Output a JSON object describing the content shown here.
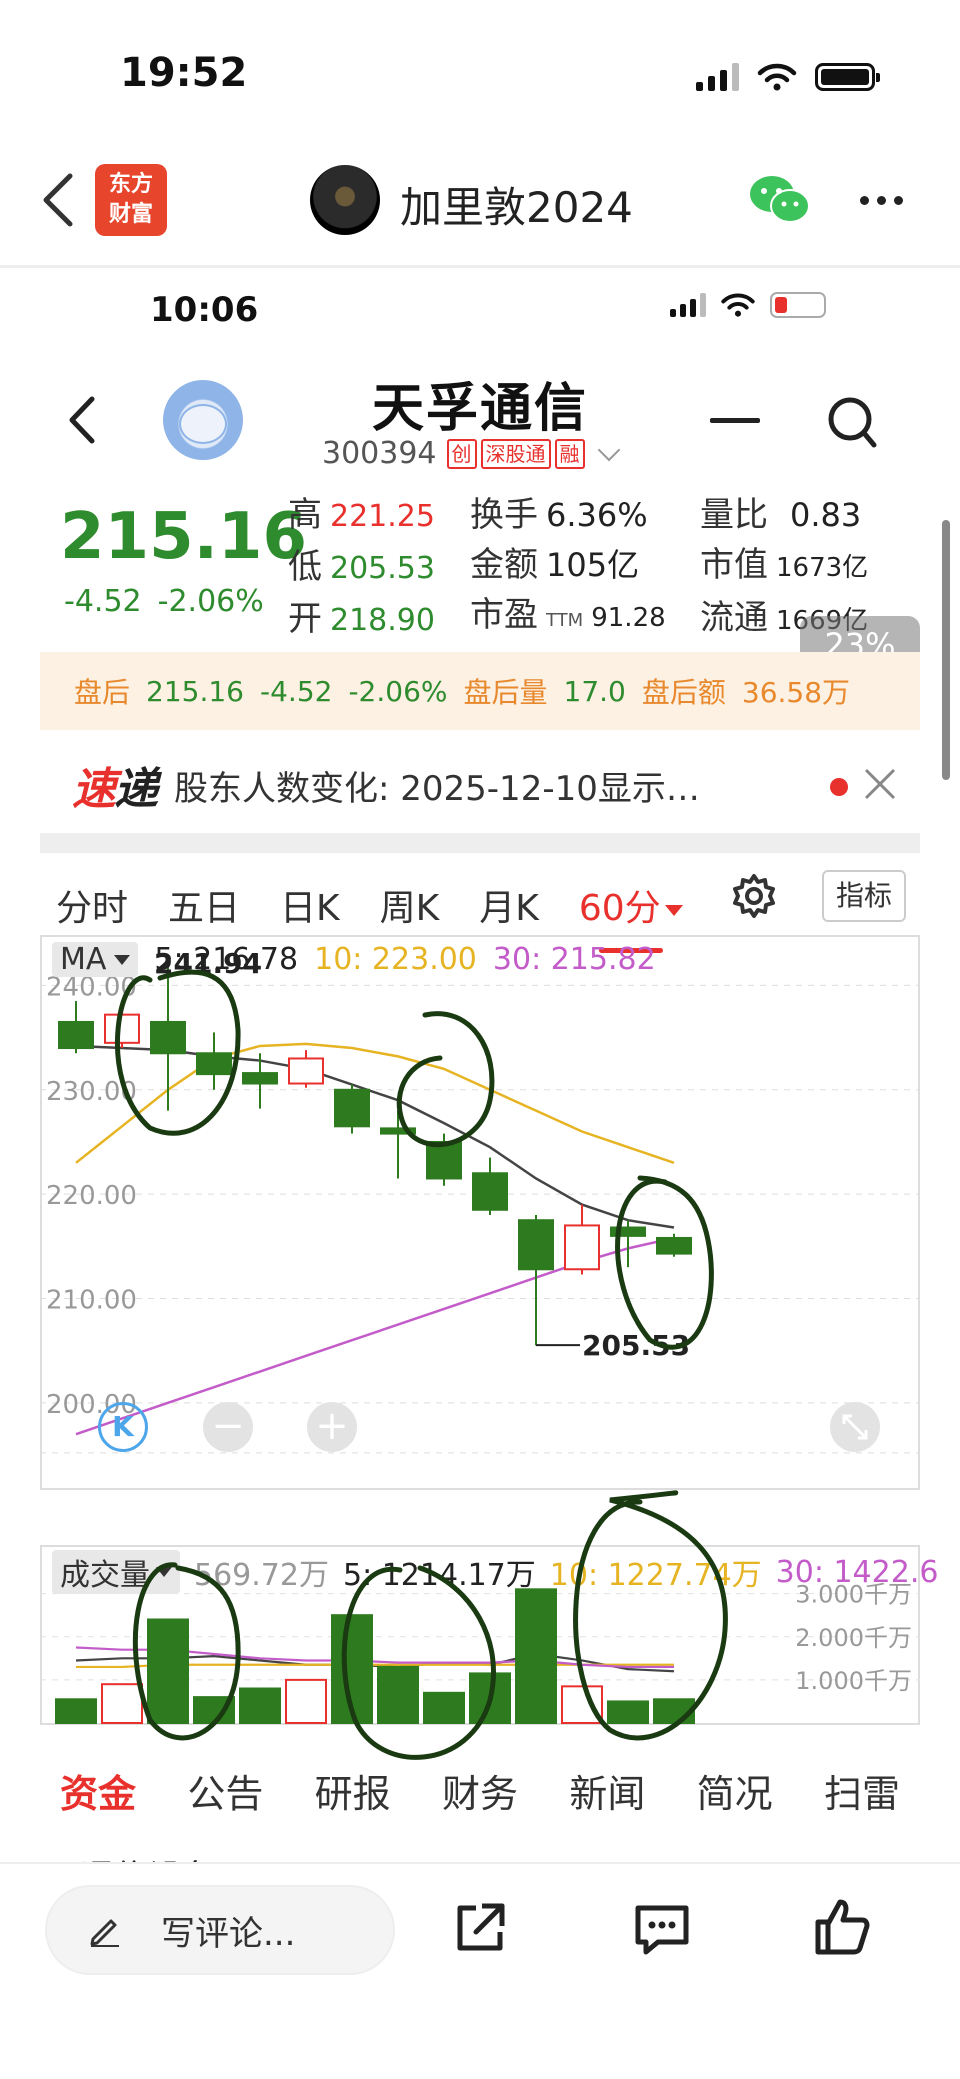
{
  "outer_status": {
    "time": "19:52"
  },
  "outer_nav": {
    "app_logo_line1": "东方",
    "app_logo_line2": "财富",
    "title": "加里敦2024"
  },
  "inner_status": {
    "time": "10:06"
  },
  "stock": {
    "name": "天孚通信",
    "code": "300394",
    "tags": [
      "创",
      "深股通",
      "融"
    ]
  },
  "quote": {
    "price": "215.16",
    "change": "-4.52",
    "change_pct": "-2.06%",
    "high_label": "高",
    "high": "221.25",
    "low_label": "低",
    "low": "205.53",
    "open_label": "开",
    "open": "218.90",
    "turnover_label": "换手",
    "turnover": "6.36%",
    "amount_label": "金额",
    "amount": "105亿",
    "pe_label": "市盈",
    "pe_suffix": "TTM",
    "pe": "91.28",
    "vol_ratio_label": "量比",
    "vol_ratio": "0.83",
    "mktcap_label": "市值",
    "mktcap": "1673亿",
    "float_label": "流通",
    "float": "1669亿",
    "scroll_pct": "23%"
  },
  "after_hours": {
    "label": "盘后",
    "price": "215.16",
    "change": "-4.52",
    "change_pct": "-2.06%",
    "vol_label": "盘后量",
    "vol": "17.0",
    "amt_label": "盘后额",
    "amt": "36.58万"
  },
  "news": {
    "logo_a": "速",
    "logo_b": "递",
    "text": "股东人数变化: 2025-12-10显示…"
  },
  "period_tabs": [
    "分时",
    "五日",
    "日K",
    "周K",
    "月K",
    "60分"
  ],
  "active_period": "60分",
  "indicator_btn": "指标",
  "ma": {
    "label": "MA",
    "ma5": "5: 216.78",
    "ma10": "10: 223.00",
    "ma30": "30: 215.82"
  },
  "volume": {
    "label": "成交量",
    "vol": "569.72万",
    "ma5": "5: 1214.17万",
    "ma10": "10: 1227.74万",
    "ma30": "30: 1422.6"
  },
  "colors": {
    "up": "#e8302d",
    "down": "#2e7a1f",
    "ma5": "#444444",
    "ma10": "#e6b422",
    "ma30": "#c35cc9",
    "annotation": "#1a3a12"
  },
  "chart_data": [
    {
      "type": "candlestick",
      "title": "",
      "yticks": [
        "240.00",
        "230.00",
        "220.00",
        "210.00",
        "200.00"
      ],
      "ylim": [
        195,
        241
      ],
      "annotations": [
        "241.94",
        "205.53"
      ],
      "candles": [
        {
          "o": 236.5,
          "c": 234.0,
          "h": 238.5,
          "l": 233.5
        },
        {
          "o": 234.5,
          "c": 237.2,
          "h": 238.0,
          "l": 234.0
        },
        {
          "o": 236.5,
          "c": 233.5,
          "h": 241.9,
          "l": 228.0
        },
        {
          "o": 233.5,
          "c": 231.5,
          "h": 235.5,
          "l": 230.0
        },
        {
          "o": 231.6,
          "c": 230.6,
          "h": 233.5,
          "l": 228.2
        },
        {
          "o": 230.6,
          "c": 233.0,
          "h": 233.8,
          "l": 230.2
        },
        {
          "o": 230.0,
          "c": 226.5,
          "h": 230.5,
          "l": 225.8
        },
        {
          "o": 226.3,
          "c": 225.8,
          "h": 228.0,
          "l": 221.5
        },
        {
          "o": 225.0,
          "c": 221.5,
          "h": 225.8,
          "l": 220.8
        },
        {
          "o": 222.0,
          "c": 218.5,
          "h": 223.5,
          "l": 218.0
        },
        {
          "o": 217.5,
          "c": 212.8,
          "h": 218.0,
          "l": 205.5
        },
        {
          "o": 212.8,
          "c": 217.0,
          "h": 219.0,
          "l": 212.3
        },
        {
          "o": 216.8,
          "c": 216.0,
          "h": 217.5,
          "l": 213.0
        },
        {
          "o": 215.8,
          "c": 214.3,
          "h": 216.2,
          "l": 214.0
        }
      ],
      "ma5_series": [
        234.2,
        234.0,
        233.8,
        233.2,
        232.8,
        232.0,
        230.5,
        229.0,
        226.8,
        224.5,
        221.5,
        219.0,
        217.5,
        216.8
      ],
      "ma10_series": [
        223.0,
        226.5,
        230.0,
        233.0,
        234.2,
        234.4,
        234.0,
        233.2,
        232.0,
        230.0,
        228.0,
        226.0,
        224.5,
        223.0
      ],
      "ma30_series": [
        197.0,
        198.5,
        200.0,
        201.5,
        203.0,
        204.5,
        206.0,
        207.5,
        209.0,
        210.5,
        212.0,
        213.5,
        214.8,
        215.8
      ]
    },
    {
      "type": "bar",
      "title": "",
      "yticks": [
        "3.000千万",
        "2.000千万",
        "1.000千万"
      ],
      "ylim": [
        0,
        3.2
      ],
      "values": [
        0.55,
        0.9,
        2.4,
        0.6,
        0.8,
        1.0,
        2.5,
        1.3,
        0.7,
        1.15,
        3.1,
        0.85,
        0.5,
        0.55
      ],
      "up": [
        false,
        true,
        false,
        false,
        false,
        true,
        false,
        false,
        false,
        false,
        false,
        true,
        false,
        false
      ],
      "ma_lines": [
        [
          1.45,
          1.5,
          1.5,
          1.55,
          1.45,
          1.35,
          1.35,
          1.3,
          1.4,
          1.35,
          1.6,
          1.45,
          1.25,
          1.2
        ],
        [
          1.3,
          1.3,
          1.35,
          1.35,
          1.35,
          1.35,
          1.35,
          1.35,
          1.35,
          1.35,
          1.35,
          1.35,
          1.35,
          1.35
        ],
        [
          1.75,
          1.7,
          1.7,
          1.6,
          1.5,
          1.45,
          1.45,
          1.4,
          1.4,
          1.4,
          1.45,
          1.35,
          1.3,
          1.3
        ]
      ]
    }
  ],
  "bottom_tabs": [
    "资金",
    "公告",
    "研报",
    "财务",
    "新闻",
    "简况",
    "扫雷"
  ],
  "cut_row": "通信设备",
  "comment_placeholder": "写评论..."
}
